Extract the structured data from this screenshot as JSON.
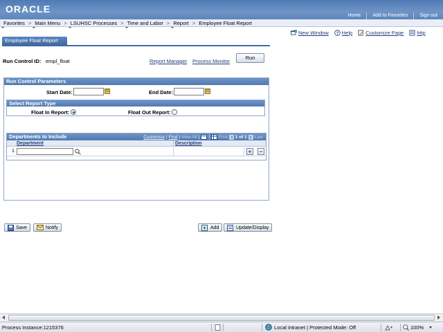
{
  "header": {
    "logo": "ORACLE",
    "links": [
      "Home",
      "Add to Favorites",
      "Sign out"
    ]
  },
  "nav": {
    "items": [
      "Favorites",
      "Main Menu",
      "LSUHSC Processes",
      "Time and Labor",
      "Report",
      "Employee Float Report"
    ],
    "separator": ">"
  },
  "tools": {
    "new_window": "New Window",
    "help": "Help",
    "customize_page": "Customize Page",
    "http": "http"
  },
  "page": {
    "tab": "Employee Float Report",
    "run_control_label": "Run Control ID:",
    "run_control_value": "empl_float",
    "report_manager": "Report Manager",
    "process_monitor": "Process Monitor",
    "run_button": "Run"
  },
  "params": {
    "title": "Run Control Parameters",
    "start_date_label": "Start Date:",
    "start_date_value": "",
    "end_date_label": "End Date:",
    "end_date_value": "",
    "report_type_title": "Select Report Type",
    "float_in_label": "Float In Report:",
    "float_out_label": "Float Out Report:",
    "selected": "float_in"
  },
  "grid": {
    "title": "Departments to Include",
    "customize": "Customize",
    "find": "Find",
    "view_all": "View All",
    "first": "First",
    "pager": "1 of 1",
    "last": "Last",
    "columns": [
      "Department",
      "Description"
    ],
    "rows": [
      {
        "num": "1",
        "department": "",
        "description": ""
      }
    ]
  },
  "buttons": {
    "save": "Save",
    "notify": "Notify",
    "add": "Add",
    "update_display": "Update/Display"
  },
  "status": {
    "left": "Process Instance:1215376",
    "zone": "Local intranet | Protected Mode: Off",
    "zoom": "100%"
  },
  "colors": {
    "header_blue": "#4f7ab3",
    "link_blue": "#1f3a7a"
  }
}
